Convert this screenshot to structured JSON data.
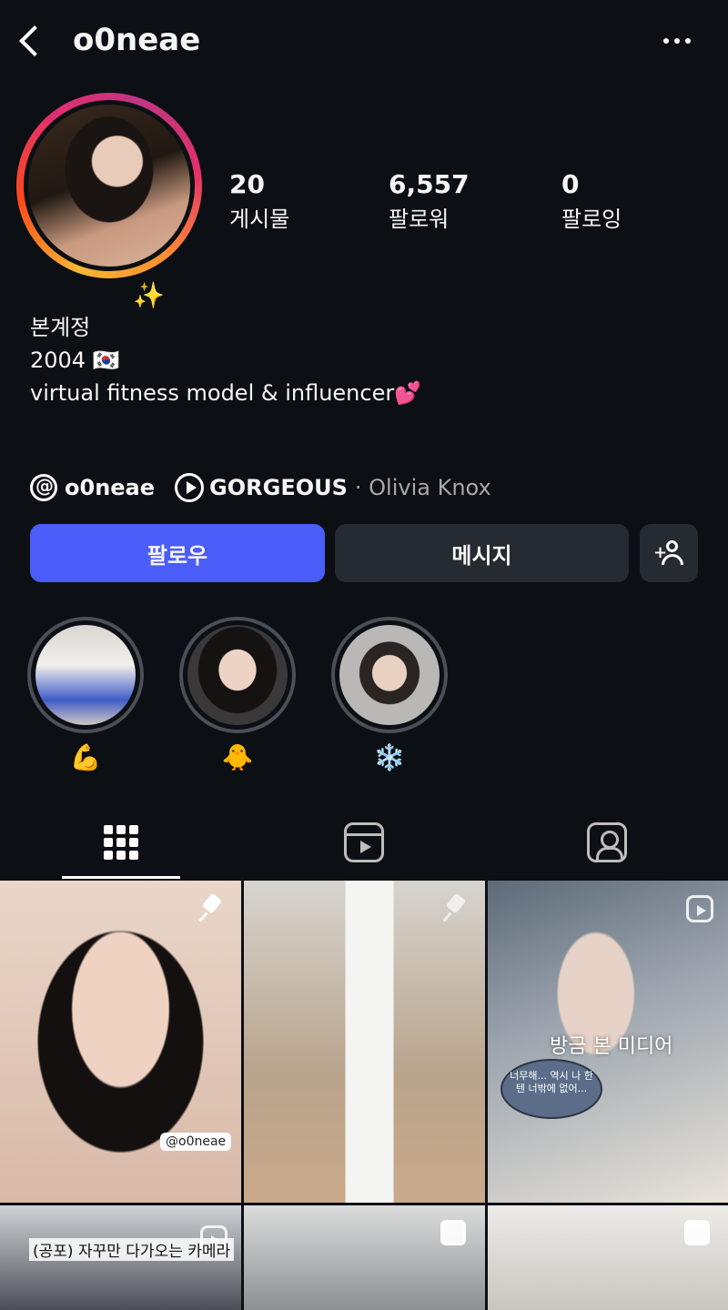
{
  "header": {
    "username": "o0neae"
  },
  "profile": {
    "stats": [
      {
        "num": "20",
        "label": "게시물"
      },
      {
        "num": "6,557",
        "label": "팔로워"
      },
      {
        "num": "0",
        "label": "팔로잉"
      }
    ],
    "sparkle": "✨",
    "bio": {
      "line1": "본계정",
      "line2": "2004 🇰🇷",
      "line3": "virtual fitness model & influencer💕"
    },
    "links": {
      "threads_handle": "o0neae",
      "music_title": "GORGEOUS",
      "music_artist": "· Olivia Knox"
    }
  },
  "actions": {
    "follow_label": "팔로우",
    "message_label": "메시지",
    "add_plus": "+"
  },
  "highlights": [
    {
      "label": "💪"
    },
    {
      "label": "🐥"
    },
    {
      "label": "❄️"
    }
  ],
  "posts": {
    "watermark": "@o0neae",
    "recent_media_label": "방금 본 미디어",
    "bubble_text": "너무해... 역시 나 한텐 너밖에 없어...",
    "p4_caption": "(공포) 자꾸만 다가오는 카메라"
  },
  "colors": {
    "background": "#0c0f14",
    "follow_button": "#4a5df9",
    "secondary_button": "#262a31"
  }
}
